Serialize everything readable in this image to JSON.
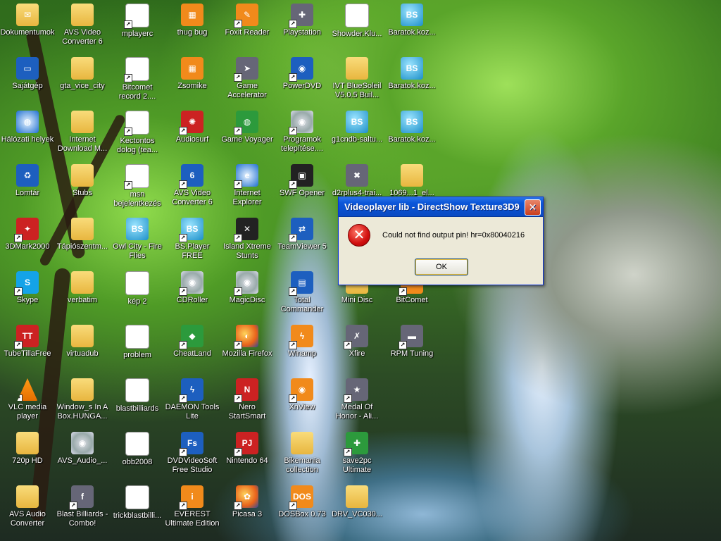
{
  "dialog": {
    "title": "Videoplayer lib - DirectShow Texture3D9",
    "close_symbol": "✕",
    "icon": "error-icon",
    "message": "Could not find output pin!  hr=0x80040216",
    "ok_label": "OK"
  },
  "icons": [
    {
      "label": "Dokumentumok",
      "glyph": "✉",
      "style": "ic-folder",
      "shortcut": false
    },
    {
      "label": "AVS Video\nConverter 6",
      "glyph": "",
      "style": "ic-folder",
      "shortcut": false
    },
    {
      "label": "mplayerc",
      "glyph": "321",
      "style": "ic-doc",
      "shortcut": true
    },
    {
      "label": "thug bug",
      "glyph": "▦",
      "style": "ic-orange",
      "shortcut": false
    },
    {
      "label": "Foxit Reader",
      "glyph": "✎",
      "style": "ic-orange",
      "shortcut": true
    },
    {
      "label": "Playstation",
      "glyph": "✚",
      "style": "ic-gray",
      "shortcut": true
    },
    {
      "label": "Showder.Klu...",
      "glyph": "●",
      "style": "ic-doc",
      "shortcut": false
    },
    {
      "label": "Baratok.koz...",
      "glyph": "BS",
      "style": "ic-bs",
      "shortcut": false
    },
    {
      "label": "Sajátgép",
      "glyph": "▭",
      "style": "ic-blue",
      "shortcut": false
    },
    {
      "label": "gta_vice_city",
      "glyph": "",
      "style": "ic-folder",
      "shortcut": false
    },
    {
      "label": "Bitcomet\nrecord 2....",
      "glyph": "≡",
      "style": "ic-doc",
      "shortcut": true
    },
    {
      "label": "Zsomike",
      "glyph": "▦",
      "style": "ic-orange",
      "shortcut": false
    },
    {
      "label": "Game\nAccelerator",
      "glyph": "➤",
      "style": "ic-gray",
      "shortcut": true
    },
    {
      "label": "PowerDVD",
      "glyph": "◉",
      "style": "ic-blue",
      "shortcut": true
    },
    {
      "label": "IVT BlueSoleil\nV5.0.5 Buil...",
      "glyph": "",
      "style": "ic-folder",
      "shortcut": false
    },
    {
      "label": "Baratok.koz...",
      "glyph": "BS",
      "style": "ic-bs",
      "shortcut": false
    },
    {
      "label": "Hálózati helyek",
      "glyph": "◍",
      "style": "ic-ie",
      "shortcut": false
    },
    {
      "label": "Internet\nDownload M...",
      "glyph": "",
      "style": "ic-folder",
      "shortcut": false
    },
    {
      "label": "Kectontos\ndolog (tea...",
      "glyph": "≡",
      "style": "ic-doc",
      "shortcut": true
    },
    {
      "label": "Audiosurf",
      "glyph": "✺",
      "style": "ic-red",
      "shortcut": true
    },
    {
      "label": "Game Voyager",
      "glyph": "◍",
      "style": "ic-green",
      "shortcut": true
    },
    {
      "label": "Programok\ntelepítése....",
      "glyph": "◉",
      "style": "ic-disc",
      "shortcut": true
    },
    {
      "label": "g1cndb-saltu...",
      "glyph": "BS",
      "style": "ic-bs",
      "shortcut": false
    },
    {
      "label": "Baratok.koz...",
      "glyph": "BS",
      "style": "ic-bs",
      "shortcut": false
    },
    {
      "label": "Lomtár",
      "glyph": "♻",
      "style": "ic-blue",
      "shortcut": false
    },
    {
      "label": "Stubs",
      "glyph": "",
      "style": "ic-folder",
      "shortcut": false
    },
    {
      "label": "msn\nbejelentkezés",
      "glyph": "≡",
      "style": "ic-doc",
      "shortcut": true
    },
    {
      "label": "AVS Video\nConverter 6",
      "glyph": "6",
      "style": "ic-blue",
      "shortcut": true
    },
    {
      "label": "Internet\nExplorer",
      "glyph": "e",
      "style": "ic-ie",
      "shortcut": true
    },
    {
      "label": "SWF Opener",
      "glyph": "▣",
      "style": "ic-dark",
      "shortcut": true
    },
    {
      "label": "d2rplus4-trai...",
      "glyph": "✖",
      "style": "ic-gray",
      "shortcut": false
    },
    {
      "label": "1069...1_el...",
      "glyph": "",
      "style": "ic-folder",
      "shortcut": false
    },
    {
      "label": "3DMark2000",
      "glyph": "✦",
      "style": "ic-red",
      "shortcut": true
    },
    {
      "label": "Tápiószentm...",
      "glyph": "",
      "style": "ic-folder",
      "shortcut": false
    },
    {
      "label": "Owl City - Fire\nFlies",
      "glyph": "BS",
      "style": "ic-bs",
      "shortcut": false
    },
    {
      "label": "BS.Player FREE",
      "glyph": "BS",
      "style": "ic-bs",
      "shortcut": true
    },
    {
      "label": "Island Xtreme\nStunts",
      "glyph": "✕",
      "style": "ic-dark",
      "shortcut": true
    },
    {
      "label": "TeamViewer 5",
      "glyph": "⇄",
      "style": "ic-blue",
      "shortcut": true
    },
    {
      "label": "Skype",
      "glyph": "S",
      "style": "ic-skype",
      "shortcut": true
    },
    {
      "label": "verbatim",
      "glyph": "",
      "style": "ic-folder",
      "shortcut": false
    },
    {
      "label": "kép 2",
      "glyph": "▭",
      "style": "ic-doc",
      "shortcut": false
    },
    {
      "label": "CDRoller",
      "glyph": "◉",
      "style": "ic-disc",
      "shortcut": true
    },
    {
      "label": "MagicDisc",
      "glyph": "◉",
      "style": "ic-disc",
      "shortcut": true
    },
    {
      "label": "Total\nCommander",
      "glyph": "▤",
      "style": "ic-blue",
      "shortcut": true
    },
    {
      "label": "Mini Disc",
      "glyph": "",
      "style": "ic-folder",
      "shortcut": false
    },
    {
      "label": "BitComet",
      "glyph": "●",
      "style": "ic-orange",
      "shortcut": true
    },
    {
      "label": "TubeTillaFree",
      "glyph": "TT",
      "style": "ic-red",
      "shortcut": true
    },
    {
      "label": "virtuadub",
      "glyph": "",
      "style": "ic-folder",
      "shortcut": false
    },
    {
      "label": "problem",
      "glyph": "▭",
      "style": "ic-doc",
      "shortcut": false
    },
    {
      "label": "CheatLand",
      "glyph": "◆",
      "style": "ic-green",
      "shortcut": true
    },
    {
      "label": "Mozilla Firefox",
      "glyph": "◐",
      "style": "ic-ff",
      "shortcut": true
    },
    {
      "label": "Winamp",
      "glyph": "ϟ",
      "style": "ic-orange",
      "shortcut": true
    },
    {
      "label": "Xfire",
      "glyph": "✗",
      "style": "ic-gray",
      "shortcut": true
    },
    {
      "label": "RPM Tuning",
      "glyph": "▬",
      "style": "ic-gray",
      "shortcut": true
    },
    {
      "label": "VLC media\nplayer",
      "glyph": "",
      "style": "ic-cone",
      "shortcut": true
    },
    {
      "label": "Window_s In A\nBox.HUNGA...",
      "glyph": "",
      "style": "ic-folder",
      "shortcut": false
    },
    {
      "label": "blastbilliards",
      "glyph": "▭",
      "style": "ic-doc",
      "shortcut": false
    },
    {
      "label": "DAEMON Tools\nLite",
      "glyph": "ϟ",
      "style": "ic-blue",
      "shortcut": true
    },
    {
      "label": "Nero\nStartSmart",
      "glyph": "N",
      "style": "ic-red",
      "shortcut": true
    },
    {
      "label": "XnView",
      "glyph": "◉",
      "style": "ic-orange",
      "shortcut": true
    },
    {
      "label": "Medal Of\nHonor - Ali...",
      "glyph": "★",
      "style": "ic-gray",
      "shortcut": true
    },
    {
      "label": "720p HD",
      "glyph": "",
      "style": "ic-folder",
      "shortcut": false
    },
    {
      "label": "AVS_Audio_...",
      "glyph": "◉",
      "style": "ic-disc",
      "shortcut": false
    },
    {
      "label": "obb2008",
      "glyph": "▭",
      "style": "ic-doc",
      "shortcut": false
    },
    {
      "label": "DVDVideoSoft\nFree Studio",
      "glyph": "Fs",
      "style": "ic-blue",
      "shortcut": true
    },
    {
      "label": "Nintendo 64",
      "glyph": "PJ",
      "style": "ic-red",
      "shortcut": true
    },
    {
      "label": "Bikemania\ncollection",
      "glyph": "",
      "style": "ic-folder",
      "shortcut": false
    },
    {
      "label": "save2pc\nUltimate",
      "glyph": "✚",
      "style": "ic-green",
      "shortcut": true
    },
    {
      "label": "AVS Audio\nConverter",
      "glyph": "",
      "style": "ic-folder",
      "shortcut": false
    },
    {
      "label": "Blast Billiards -\nCombo!",
      "glyph": "f",
      "style": "ic-gray",
      "shortcut": true
    },
    {
      "label": "trickblastbilli...",
      "glyph": "▭",
      "style": "ic-doc",
      "shortcut": false
    },
    {
      "label": "EVEREST\nUltimate Edition",
      "glyph": "i",
      "style": "ic-orange",
      "shortcut": true
    },
    {
      "label": "Picasa 3",
      "glyph": "✿",
      "style": "ic-ff",
      "shortcut": true
    },
    {
      "label": "DOSBox 0.73",
      "glyph": "DOS",
      "style": "ic-orange",
      "shortcut": true
    },
    {
      "label": "DRV_VC030...",
      "glyph": "",
      "style": "ic-folder",
      "shortcut": false
    }
  ]
}
